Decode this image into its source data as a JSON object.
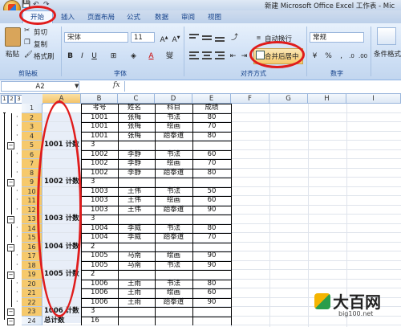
{
  "window": {
    "title": "新建 Microsoft Office Excel 工作表 - Mic"
  },
  "tabs": [
    "开始",
    "插入",
    "页面布局",
    "公式",
    "数据",
    "审阅",
    "视图"
  ],
  "ribbon": {
    "paste": "粘贴",
    "cut": "剪切",
    "copy": "复制",
    "format_painter": "格式刷",
    "font_name": "宋体",
    "font_size": "11",
    "wrap_text": "自动换行",
    "merge_center": "合并后居中",
    "number_format": "常规",
    "conditional": "条件格式",
    "groups": [
      "剪贴板",
      "字体",
      "对齐方式",
      "数字"
    ]
  },
  "formula_bar": {
    "name_box": "A2",
    "fx": "fx"
  },
  "columns": [
    "A",
    "B",
    "C",
    "D",
    "E",
    "F",
    "G",
    "H",
    "I"
  ],
  "outline_levels": [
    "1",
    "2",
    "3"
  ],
  "rows": [
    {
      "n": "1",
      "b": "考号",
      "c": "姓名",
      "d": "科目",
      "e": "成绩"
    },
    {
      "n": "2",
      "b": "1001",
      "c": "张梅",
      "d": "书法",
      "e": "80"
    },
    {
      "n": "3",
      "b": "1001",
      "c": "张梅",
      "d": "绘画",
      "e": "70"
    },
    {
      "n": "4",
      "b": "1001",
      "c": "张梅",
      "d": "跆拳道",
      "e": "80"
    },
    {
      "n": "5",
      "a": "1001 计数",
      "b": "3"
    },
    {
      "n": "6",
      "b": "1002",
      "c": "李静",
      "d": "书法",
      "e": "60"
    },
    {
      "n": "7",
      "b": "1002",
      "c": "李静",
      "d": "绘画",
      "e": "70"
    },
    {
      "n": "8",
      "b": "1002",
      "c": "李静",
      "d": "跆拳道",
      "e": "80"
    },
    {
      "n": "9",
      "a": "1002 计数",
      "b": "3"
    },
    {
      "n": "10",
      "b": "1003",
      "c": "王伟",
      "d": "书法",
      "e": "50"
    },
    {
      "n": "11",
      "b": "1003",
      "c": "王伟",
      "d": "绘画",
      "e": "60"
    },
    {
      "n": "12",
      "b": "1003",
      "c": "王伟",
      "d": "跆拳道",
      "e": "90"
    },
    {
      "n": "13",
      "a": "1003 计数",
      "b": "3"
    },
    {
      "n": "14",
      "b": "1004",
      "c": "李威",
      "d": "书法",
      "e": "80"
    },
    {
      "n": "15",
      "b": "1004",
      "c": "李威",
      "d": "跆拳道",
      "e": "70"
    },
    {
      "n": "16",
      "a": "1004 计数",
      "b": "2"
    },
    {
      "n": "17",
      "b": "1005",
      "c": "马南",
      "d": "绘画",
      "e": "90"
    },
    {
      "n": "18",
      "b": "1005",
      "c": "马南",
      "d": "书法",
      "e": "90"
    },
    {
      "n": "19",
      "a": "1005 计数",
      "b": "2"
    },
    {
      "n": "20",
      "b": "1006",
      "c": "王雨",
      "d": "书法",
      "e": "80"
    },
    {
      "n": "21",
      "b": "1006",
      "c": "王雨",
      "d": "绘画",
      "e": "60"
    },
    {
      "n": "22",
      "b": "1006",
      "c": "王雨",
      "d": "跆拳道",
      "e": "90"
    },
    {
      "n": "23",
      "a": "1006 计数",
      "b": "3"
    },
    {
      "n": "24",
      "a": "总计数",
      "b": "16"
    }
  ],
  "watermark": {
    "brand": "大百网",
    "url": "big100.net"
  },
  "annotation_color": "#e01c1c"
}
